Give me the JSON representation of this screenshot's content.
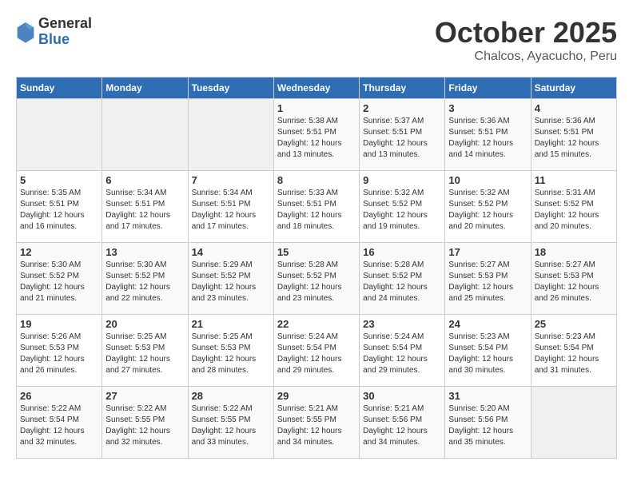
{
  "header": {
    "logo_general": "General",
    "logo_blue": "Blue",
    "month": "October 2025",
    "location": "Chalcos, Ayacucho, Peru"
  },
  "days_of_week": [
    "Sunday",
    "Monday",
    "Tuesday",
    "Wednesday",
    "Thursday",
    "Friday",
    "Saturday"
  ],
  "weeks": [
    [
      {
        "day": "",
        "info": ""
      },
      {
        "day": "",
        "info": ""
      },
      {
        "day": "",
        "info": ""
      },
      {
        "day": "1",
        "info": "Sunrise: 5:38 AM\nSunset: 5:51 PM\nDaylight: 12 hours and 13 minutes."
      },
      {
        "day": "2",
        "info": "Sunrise: 5:37 AM\nSunset: 5:51 PM\nDaylight: 12 hours and 13 minutes."
      },
      {
        "day": "3",
        "info": "Sunrise: 5:36 AM\nSunset: 5:51 PM\nDaylight: 12 hours and 14 minutes."
      },
      {
        "day": "4",
        "info": "Sunrise: 5:36 AM\nSunset: 5:51 PM\nDaylight: 12 hours and 15 minutes."
      }
    ],
    [
      {
        "day": "5",
        "info": "Sunrise: 5:35 AM\nSunset: 5:51 PM\nDaylight: 12 hours and 16 minutes."
      },
      {
        "day": "6",
        "info": "Sunrise: 5:34 AM\nSunset: 5:51 PM\nDaylight: 12 hours and 17 minutes."
      },
      {
        "day": "7",
        "info": "Sunrise: 5:34 AM\nSunset: 5:51 PM\nDaylight: 12 hours and 17 minutes."
      },
      {
        "day": "8",
        "info": "Sunrise: 5:33 AM\nSunset: 5:51 PM\nDaylight: 12 hours and 18 minutes."
      },
      {
        "day": "9",
        "info": "Sunrise: 5:32 AM\nSunset: 5:52 PM\nDaylight: 12 hours and 19 minutes."
      },
      {
        "day": "10",
        "info": "Sunrise: 5:32 AM\nSunset: 5:52 PM\nDaylight: 12 hours and 20 minutes."
      },
      {
        "day": "11",
        "info": "Sunrise: 5:31 AM\nSunset: 5:52 PM\nDaylight: 12 hours and 20 minutes."
      }
    ],
    [
      {
        "day": "12",
        "info": "Sunrise: 5:30 AM\nSunset: 5:52 PM\nDaylight: 12 hours and 21 minutes."
      },
      {
        "day": "13",
        "info": "Sunrise: 5:30 AM\nSunset: 5:52 PM\nDaylight: 12 hours and 22 minutes."
      },
      {
        "day": "14",
        "info": "Sunrise: 5:29 AM\nSunset: 5:52 PM\nDaylight: 12 hours and 23 minutes."
      },
      {
        "day": "15",
        "info": "Sunrise: 5:28 AM\nSunset: 5:52 PM\nDaylight: 12 hours and 23 minutes."
      },
      {
        "day": "16",
        "info": "Sunrise: 5:28 AM\nSunset: 5:52 PM\nDaylight: 12 hours and 24 minutes."
      },
      {
        "day": "17",
        "info": "Sunrise: 5:27 AM\nSunset: 5:53 PM\nDaylight: 12 hours and 25 minutes."
      },
      {
        "day": "18",
        "info": "Sunrise: 5:27 AM\nSunset: 5:53 PM\nDaylight: 12 hours and 26 minutes."
      }
    ],
    [
      {
        "day": "19",
        "info": "Sunrise: 5:26 AM\nSunset: 5:53 PM\nDaylight: 12 hours and 26 minutes."
      },
      {
        "day": "20",
        "info": "Sunrise: 5:25 AM\nSunset: 5:53 PM\nDaylight: 12 hours and 27 minutes."
      },
      {
        "day": "21",
        "info": "Sunrise: 5:25 AM\nSunset: 5:53 PM\nDaylight: 12 hours and 28 minutes."
      },
      {
        "day": "22",
        "info": "Sunrise: 5:24 AM\nSunset: 5:54 PM\nDaylight: 12 hours and 29 minutes."
      },
      {
        "day": "23",
        "info": "Sunrise: 5:24 AM\nSunset: 5:54 PM\nDaylight: 12 hours and 29 minutes."
      },
      {
        "day": "24",
        "info": "Sunrise: 5:23 AM\nSunset: 5:54 PM\nDaylight: 12 hours and 30 minutes."
      },
      {
        "day": "25",
        "info": "Sunrise: 5:23 AM\nSunset: 5:54 PM\nDaylight: 12 hours and 31 minutes."
      }
    ],
    [
      {
        "day": "26",
        "info": "Sunrise: 5:22 AM\nSunset: 5:54 PM\nDaylight: 12 hours and 32 minutes."
      },
      {
        "day": "27",
        "info": "Sunrise: 5:22 AM\nSunset: 5:55 PM\nDaylight: 12 hours and 32 minutes."
      },
      {
        "day": "28",
        "info": "Sunrise: 5:22 AM\nSunset: 5:55 PM\nDaylight: 12 hours and 33 minutes."
      },
      {
        "day": "29",
        "info": "Sunrise: 5:21 AM\nSunset: 5:55 PM\nDaylight: 12 hours and 34 minutes."
      },
      {
        "day": "30",
        "info": "Sunrise: 5:21 AM\nSunset: 5:56 PM\nDaylight: 12 hours and 34 minutes."
      },
      {
        "day": "31",
        "info": "Sunrise: 5:20 AM\nSunset: 5:56 PM\nDaylight: 12 hours and 35 minutes."
      },
      {
        "day": "",
        "info": ""
      }
    ]
  ]
}
